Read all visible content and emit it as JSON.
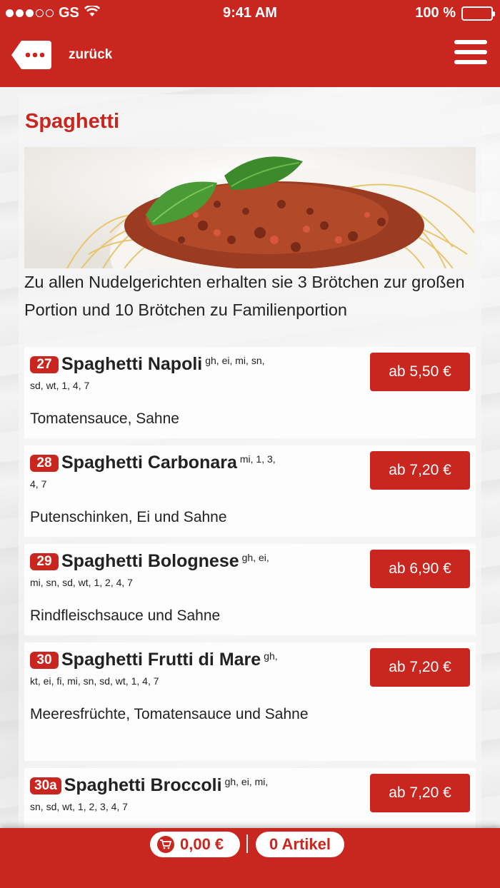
{
  "statusbar": {
    "carrier": "GS",
    "time": "9:41 AM",
    "battery": "100 %"
  },
  "header": {
    "back_label": "zurück"
  },
  "category": {
    "title": "Spaghetti",
    "intro": "Zu allen Nudelgerichten erhalten sie 3 Brötchen zur großen Portion und 10 Brötchen zu Familienportion"
  },
  "items": [
    {
      "number": "27",
      "name": "Spaghetti Napoli",
      "allergens_top": "gh, ei, mi, sn,",
      "allergens_line": "sd, wt, 1, 4, 7",
      "desc": "Tomatensauce, Sahne",
      "price": "ab 5,50 €"
    },
    {
      "number": "28",
      "name": "Spaghetti Carbonara",
      "allergens_top": "mi, 1, 3,",
      "allergens_line": "4, 7",
      "desc": "Putenschinken, Ei und Sahne",
      "price": "ab 7,20 €"
    },
    {
      "number": "29",
      "name": "Spaghetti Bolognese",
      "allergens_top": "gh, ei,",
      "allergens_line": "mi, sn, sd, wt, 1, 2, 4, 7",
      "desc": "Rindfleischsauce und Sahne",
      "price": "ab 6,90 €"
    },
    {
      "number": "30",
      "name": "Spaghetti Frutti di Mare",
      "allergens_top": "gh,",
      "allergens_line": "kt, ei, fi, mi, sn, sd, wt, 1, 4, 7",
      "desc": "Meeresfrüchte, Tomatensauce und Sahne",
      "price": "ab 7,20 €"
    },
    {
      "number": "30a",
      "name": "Spaghetti Broccoli",
      "allergens_top": "gh, ei, mi,",
      "allergens_line": "sn, sd, wt, 1, 2, 3, 4, 7",
      "desc": "",
      "price": "ab 7,20 €"
    }
  ],
  "cart": {
    "total": "0,00 €",
    "articles": "0 Artikel"
  },
  "colors": {
    "brand": "#c8261f"
  },
  "icons": [
    "wifi-icon",
    "battery-icon",
    "back-tag-icon",
    "menu-icon",
    "cart-icon"
  ]
}
